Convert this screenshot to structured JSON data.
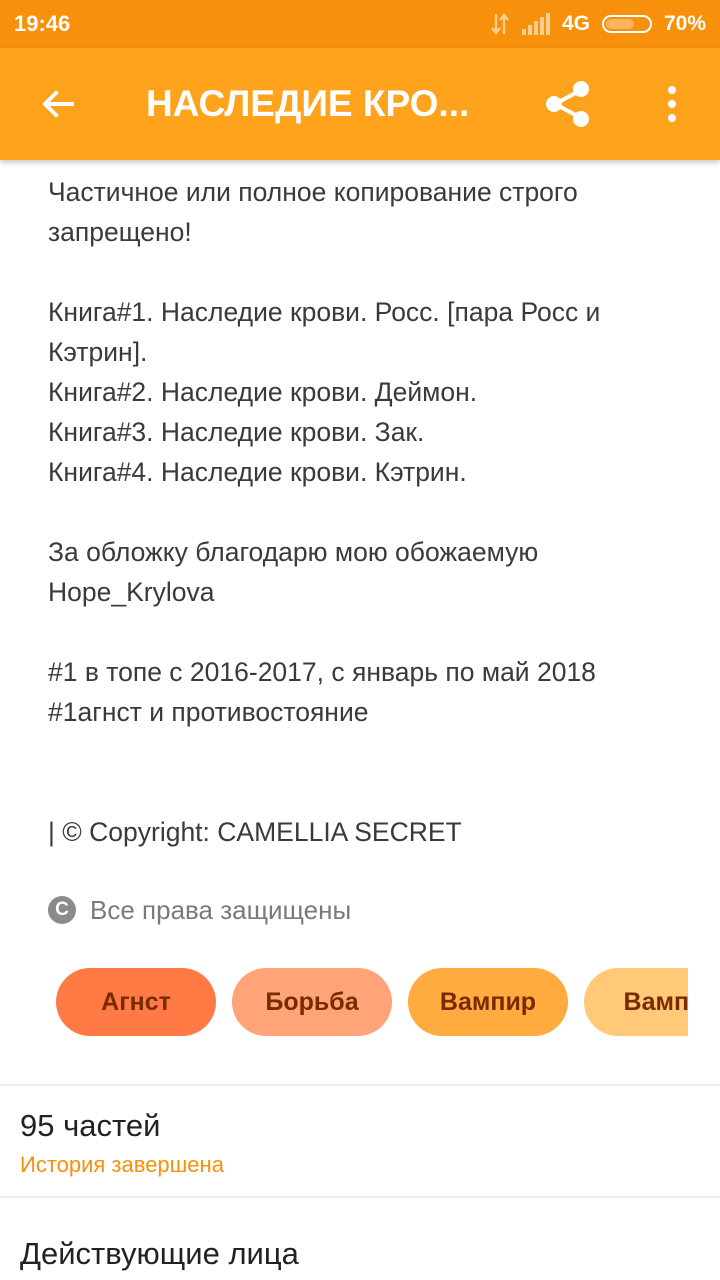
{
  "status_bar": {
    "time": "19:46",
    "network": "4G",
    "battery": "70%",
    "icons": [
      "data-arrows-icon",
      "signal-icon",
      "battery-icon"
    ]
  },
  "toolbar": {
    "title": "НАСЛЕДИЕ КРО...",
    "back_icon": "arrow-back-icon",
    "share_icon": "share-icon",
    "more_icon": "more-vert-icon",
    "color": "#ffa21c"
  },
  "description": {
    "line1": "Частичное или полное копирование строго запрещено!",
    "book1": "Книга#1. Наследие крови. Росс. [пара Росс и Кэтрин].",
    "book2": "Книга#2. Наследие крови. Деймон.",
    "book3": "Книга#3. Наследие крови. Зак.",
    "book4": "Книга#4. Наследие крови. Кэтрин.",
    "cover": "За обложку благодарю мою обожаемую Hope_Krylova",
    "rank1": "#1 в топе с 2016-2017, с январь по май 2018",
    "rank2": "#1агнст и противостояние",
    "copyright": "| © Copyright: CAMELLIA SECRET"
  },
  "rights": {
    "icon": "copyright-icon",
    "symbol": "C",
    "label": "Все права защищены"
  },
  "tags": [
    {
      "label": "Агнст",
      "color": "#ff7a45"
    },
    {
      "label": "Борьба",
      "color": "#ffa479"
    },
    {
      "label": "Вампир",
      "color": "#ffab40"
    },
    {
      "label": "Вампи",
      "color": "#ffc978"
    }
  ],
  "info": {
    "parts": "95 частей",
    "status": "История завершена",
    "characters_heading": "Действующие лица"
  }
}
